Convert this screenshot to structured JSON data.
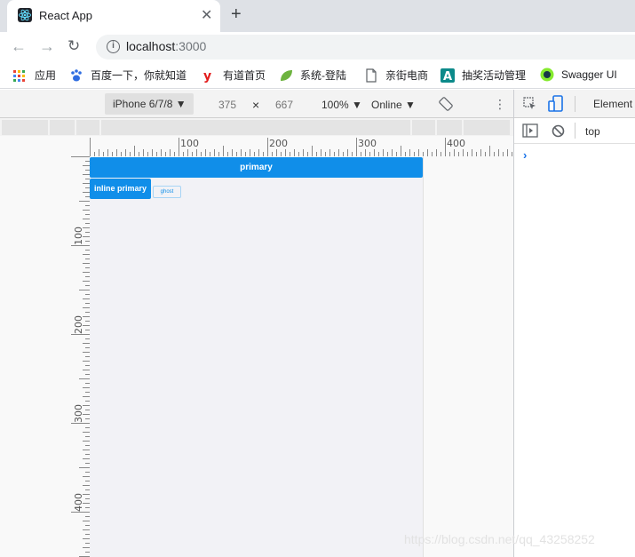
{
  "browser": {
    "tab_title": "React App",
    "url_host": "localhost",
    "url_port": ":3000",
    "icons": {
      "back": "arrow-left-icon",
      "forward": "arrow-right-icon",
      "reload": "reload-icon",
      "info": "info-icon",
      "close": "close-icon",
      "new_tab": "plus-icon"
    }
  },
  "bookmarks": [
    {
      "label": "应用",
      "icon": "apps-grid-icon"
    },
    {
      "label": "百度一下，你就知道",
      "icon": "baidu-paw-icon"
    },
    {
      "label": "有道首页",
      "icon": "youdao-icon"
    },
    {
      "label": "系统-登陆",
      "icon": "leaf-icon"
    },
    {
      "label": "亲街电商",
      "icon": "page-icon"
    },
    {
      "label": "抽奖活动管理",
      "icon": "a-letter-icon"
    },
    {
      "label": "Swagger UI",
      "icon": "swagger-icon"
    }
  ],
  "device_toolbar": {
    "device": "iPhone 6/7/8",
    "width": "375",
    "times": "×",
    "height": "667",
    "zoom": "100%",
    "network": "Online"
  },
  "ruler": {
    "top_labels": [
      "100",
      "200",
      "300",
      "400"
    ],
    "left_labels": [
      "100",
      "200",
      "300",
      "400"
    ]
  },
  "page": {
    "primary_label": "primary",
    "inline_primary_label": "inline primary",
    "ghost_label": "ghost",
    "colors": {
      "primary": "#108ee9",
      "background": "#f2f2f6"
    }
  },
  "devtools": {
    "elements_tab": "Element",
    "context": "top",
    "prompt": "›"
  },
  "watermark": "https://blog.csdn.net/qq_43258252"
}
